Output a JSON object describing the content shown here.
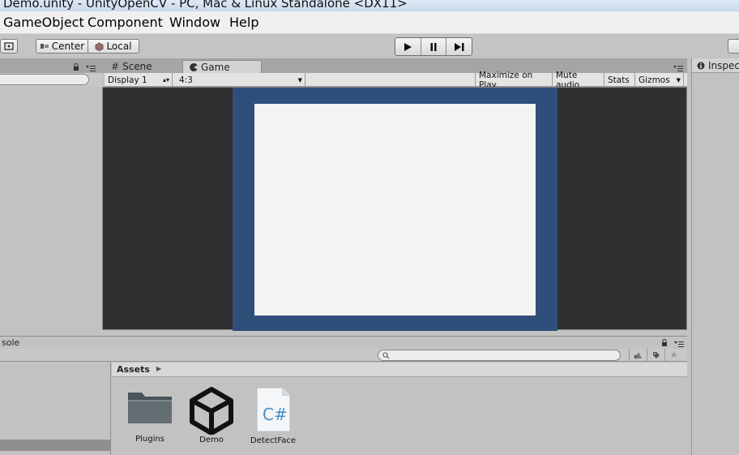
{
  "window": {
    "title": "Demo.unity - UnityOpenCV - PC, Mac & Linux Standalone <DX11>"
  },
  "menu": [
    "GameObject",
    "Component",
    "Window",
    "Help"
  ],
  "toolbar": {
    "pivot_center": "Center",
    "pivot_local": "Local"
  },
  "tabs": {
    "scene": "Scene",
    "game": "Game",
    "inspector": "Inspec"
  },
  "game_toolbar": {
    "display": "Display 1",
    "aspect": "4:3",
    "maximize": "Maximize on Play",
    "mute": "Mute audio",
    "stats": "Stats",
    "gizmos": "Gizmos"
  },
  "console": {
    "label": "sole"
  },
  "project": {
    "breadcrumb": "Assets"
  },
  "assets": [
    {
      "name": "Plugins",
      "icon": "folder-icon"
    },
    {
      "name": "Demo",
      "icon": "unity-scene-icon"
    },
    {
      "name": "DetectFace",
      "icon": "csharp-script-icon"
    }
  ],
  "colors": {
    "game_background": "#2f4f7b",
    "game_surface": "#f4f4f4",
    "viewport_dark": "#303030"
  }
}
